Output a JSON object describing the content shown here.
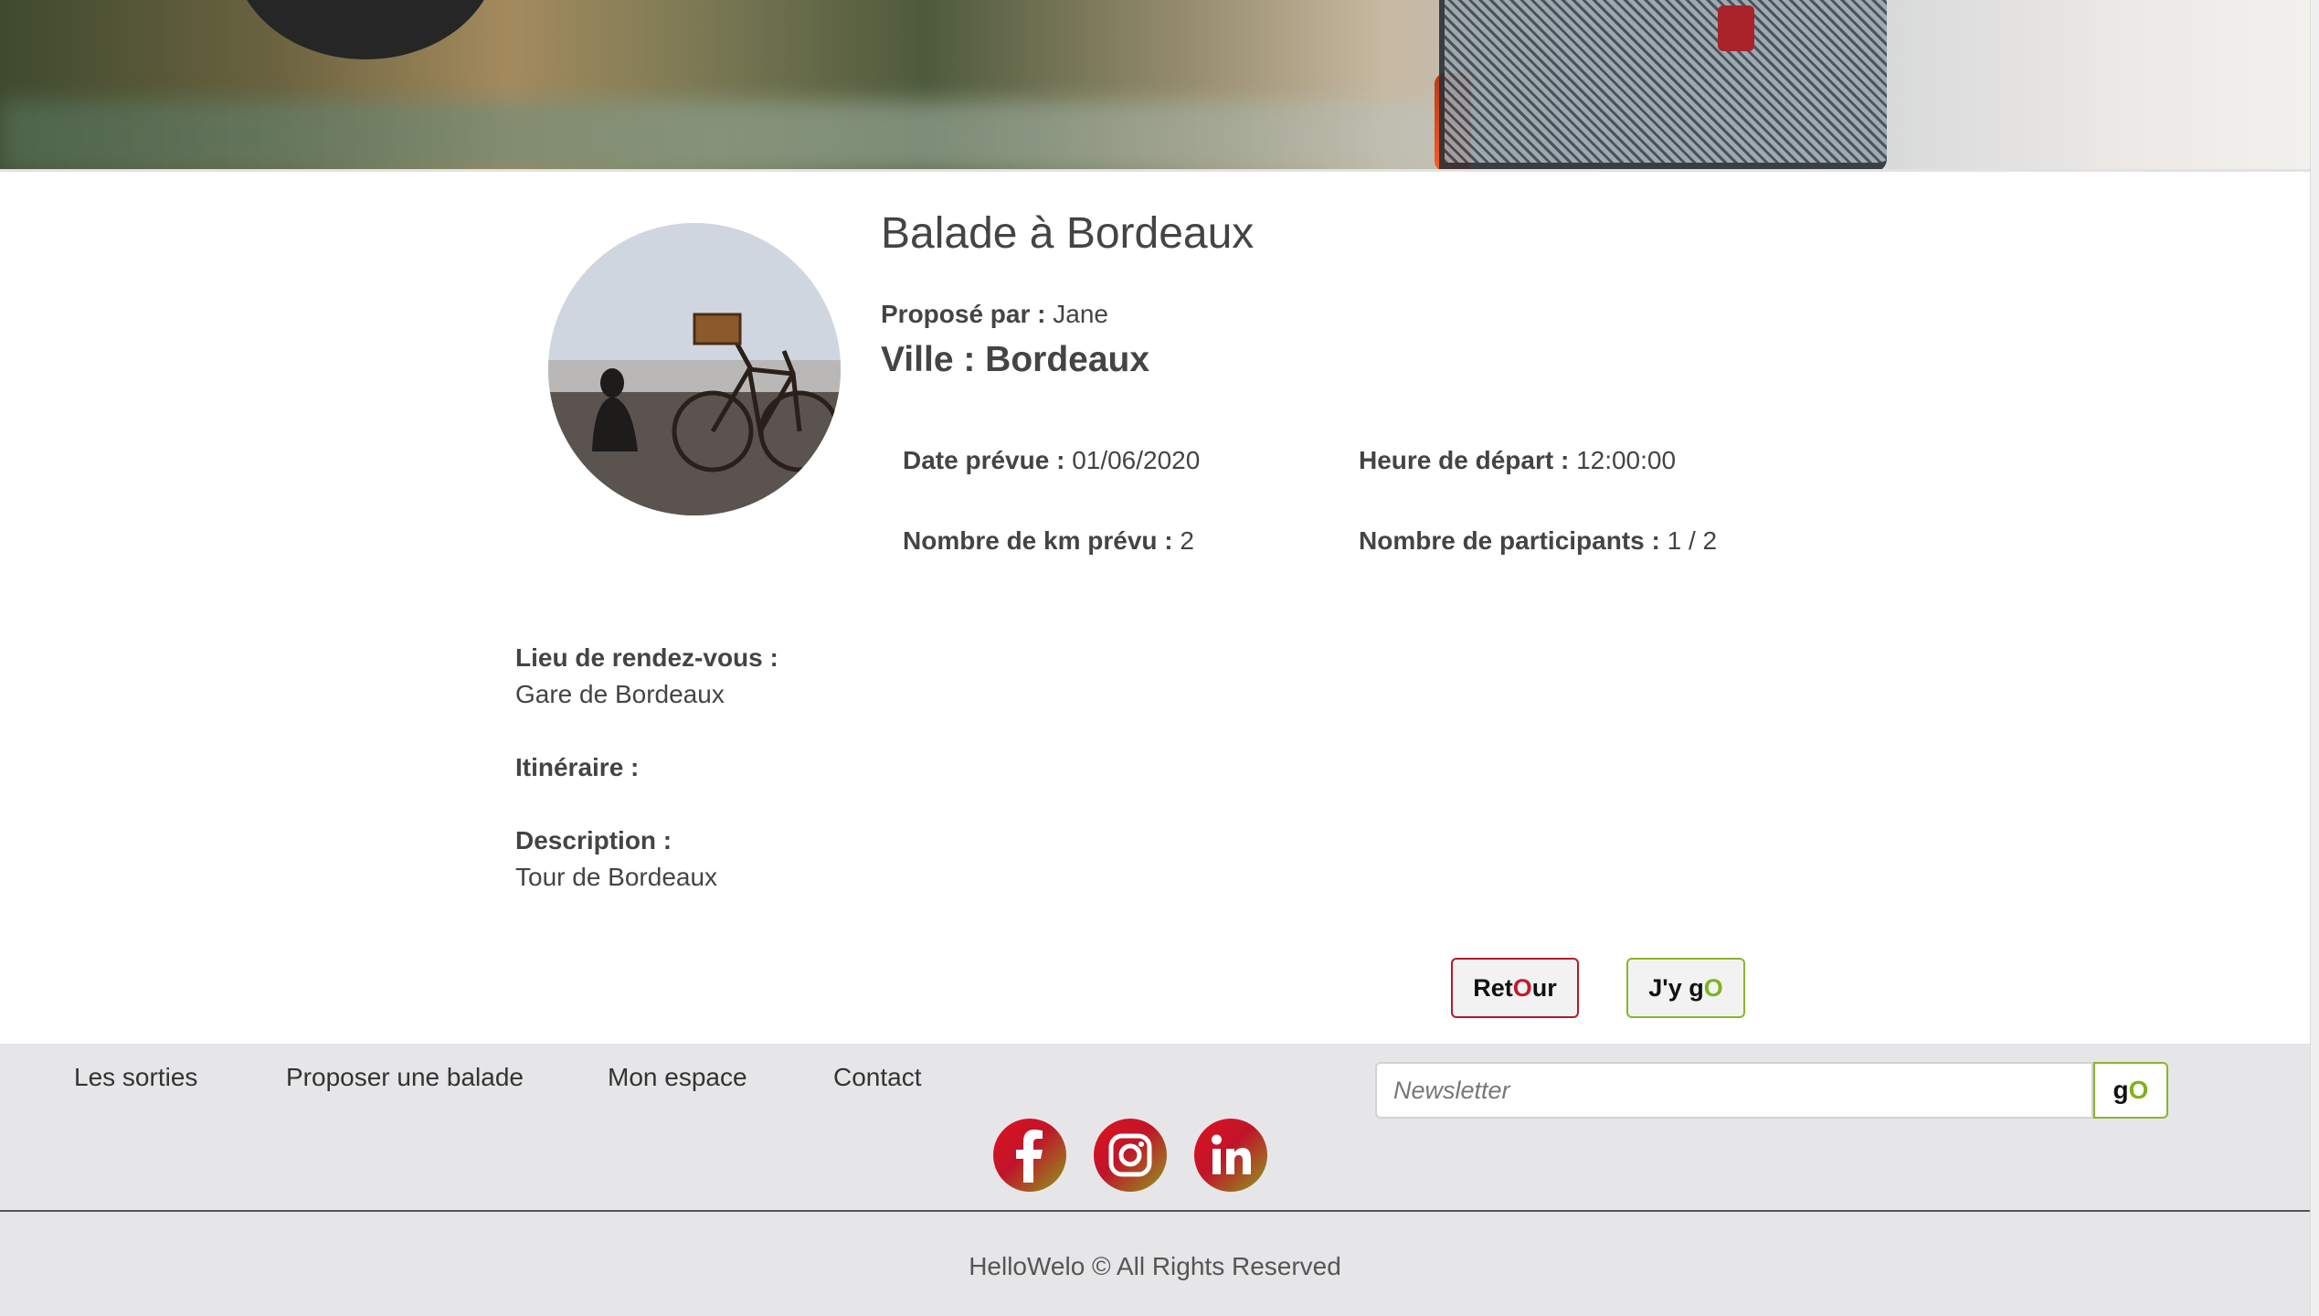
{
  "walk": {
    "title": "Balade à Bordeaux",
    "proposed_by_label": "Proposé par :",
    "proposed_by": "Jane",
    "city_label": "Ville :",
    "city": "Bordeaux",
    "date_label": "Date prévue :",
    "date": "01/06/2020",
    "departure_label": "Heure de départ :",
    "departure": "12:00:00",
    "km_label": "Nombre de km prévu :",
    "km": "2",
    "participants_label": "Nombre de participants :",
    "participants": "1 / 2",
    "meeting_label": "Lieu de rendez-vous :",
    "meeting": "Gare de Bordeaux",
    "itinerary_label": "Itinéraire :",
    "itinerary": "",
    "description_label": "Description :",
    "description": "Tour de Bordeaux"
  },
  "actions": {
    "retour_a": "Ret",
    "retour_b": "O",
    "retour_c": "ur",
    "jygo_a": "J'y g",
    "jygo_b": "O"
  },
  "footer": {
    "nav": [
      "Les sorties",
      "Proposer une balade",
      "Mon espace",
      "Contact"
    ],
    "newsletter_placeholder": "Newsletter",
    "go_a": "g",
    "go_b": "O",
    "social": [
      "facebook-icon",
      "instagram-icon",
      "linkedin-icon"
    ],
    "copyright": "HelloWelo © All Rights Reserved"
  },
  "colors": {
    "accent_red": "#c31b2c",
    "accent_green": "#7fb21e",
    "footer_bg": "#e6e6e8"
  }
}
